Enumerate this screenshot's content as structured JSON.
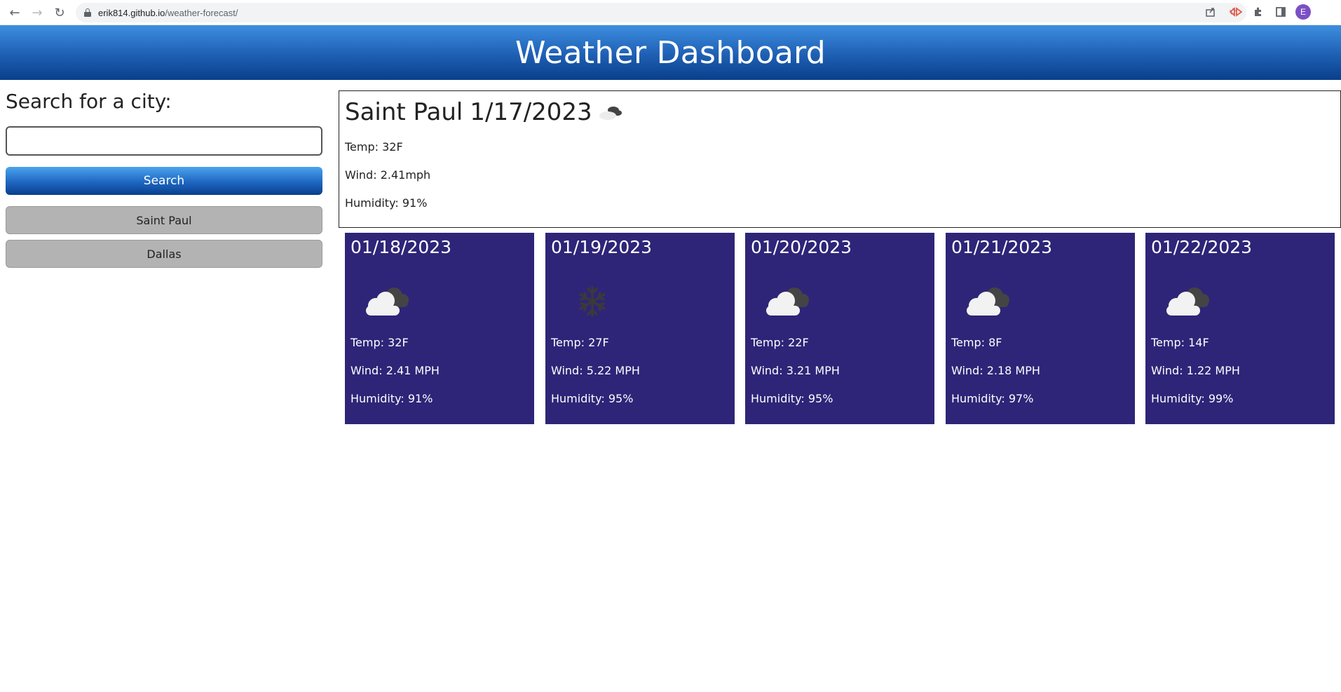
{
  "browser": {
    "url_domain": "erik814.github.io",
    "url_path": "/weather-forecast/",
    "profile_initial": "E"
  },
  "header": {
    "title": "Weather Dashboard"
  },
  "search": {
    "title": "Search for a city:",
    "input_value": "",
    "button_label": "Search",
    "history": [
      "Saint Paul",
      "Dallas"
    ]
  },
  "current": {
    "city": "Saint Paul",
    "date": "1/17/2023",
    "icon": "cloudy-icon",
    "temp": "Temp: 32F",
    "wind": "Wind: 2.41mph",
    "humidity": "Humidity: 91%"
  },
  "forecast": [
    {
      "date": "01/18/2023",
      "icon": "cloudy-icon",
      "temp": "Temp: 32F",
      "wind": "Wind: 2.41 MPH",
      "humidity": "Humidity: 91%"
    },
    {
      "date": "01/19/2023",
      "icon": "snowflake-icon",
      "temp": "Temp: 27F",
      "wind": "Wind: 5.22 MPH",
      "humidity": "Humidity: 95%"
    },
    {
      "date": "01/20/2023",
      "icon": "cloudy-icon",
      "temp": "Temp: 22F",
      "wind": "Wind: 3.21 MPH",
      "humidity": "Humidity: 95%"
    },
    {
      "date": "01/21/2023",
      "icon": "cloudy-icon",
      "temp": "Temp: 8F",
      "wind": "Wind: 2.18 MPH",
      "humidity": "Humidity: 97%"
    },
    {
      "date": "01/22/2023",
      "icon": "cloudy-icon",
      "temp": "Temp: 14F",
      "wind": "Wind: 1.22 MPH",
      "humidity": "Humidity: 99%"
    }
  ],
  "colors": {
    "header_gradient_top": "#3d8ee0",
    "header_gradient_bottom": "#0a3f8c",
    "card_bg": "#2e2578",
    "history_button_bg": "#b3b3b3"
  }
}
